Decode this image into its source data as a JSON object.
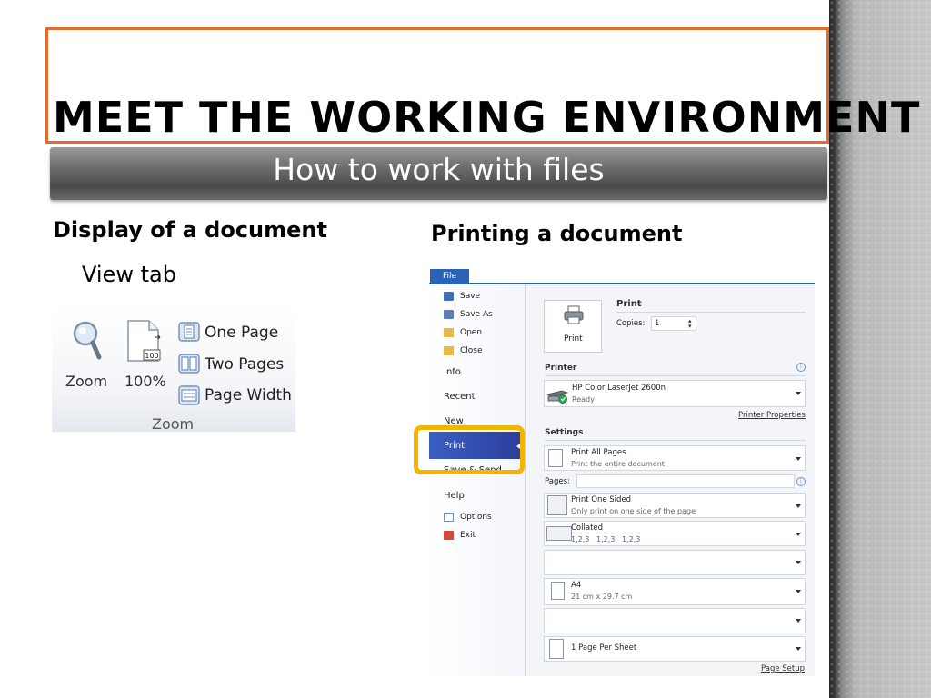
{
  "slide": {
    "title": "MEET THE WORKING ENVIRONMENT",
    "subtitle": "How to work with files",
    "left": {
      "heading": "Display of a document",
      "view_tab": "View tab",
      "ribbon": {
        "zoom_button": "Zoom",
        "percent_button": "100%",
        "percent_icon_text": "100",
        "one_page": "One Page",
        "two_pages": "Two Pages",
        "page_width": "Page Width",
        "group_label": "Zoom"
      }
    },
    "right": {
      "heading": "Printing a document"
    }
  },
  "backstage": {
    "file_tab": "File",
    "menu": {
      "save": "Save",
      "save_as": "Save As",
      "open": "Open",
      "close": "Close",
      "info": "Info",
      "recent": "Recent",
      "new": "New",
      "print": "Print",
      "save_send": "Save & Send",
      "help": "Help",
      "options": "Options",
      "exit": "Exit"
    },
    "print_panel": {
      "title": "Print",
      "copies_label": "Copies:",
      "copies_value": "1",
      "print_button": "Print",
      "printer_section": "Printer",
      "printer_name": "HP Color LaserJet 2600n",
      "printer_status": "Ready",
      "printer_properties": "Printer Properties",
      "settings_section": "Settings",
      "print_all_pages": "Print All Pages",
      "print_all_pages_sub": "Print the entire document",
      "pages_label": "Pages:",
      "print_one_sided": "Print One Sided",
      "print_one_sided_sub": "Only print on one side of the page",
      "collated": "Collated",
      "collated_sub": "1,2,3   1,2,3   1,2,3",
      "paper_size": "A4",
      "paper_size_sub": "21 cm x 29.7 cm",
      "pages_per_sheet": "1 Page Per Sheet",
      "page_setup": "Page Setup"
    }
  },
  "colors": {
    "title_border": "#e36c2a",
    "highlight": "#f4b400",
    "backstage_accent": "#2a62b8"
  }
}
